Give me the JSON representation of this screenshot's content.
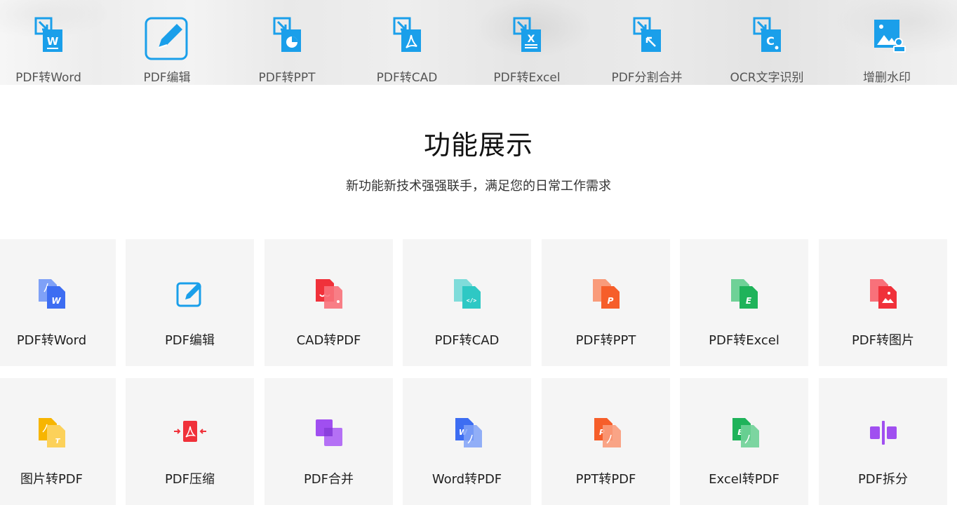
{
  "topbar": {
    "items": [
      {
        "label": "PDF转Word"
      },
      {
        "label": "PDF编辑"
      },
      {
        "label": "PDF转PPT"
      },
      {
        "label": "PDF转CAD"
      },
      {
        "label": "PDF转Excel"
      },
      {
        "label": "PDF分割合并"
      },
      {
        "label": "OCR文字识别"
      },
      {
        "label": "增删水印"
      }
    ]
  },
  "section": {
    "title": "功能展示",
    "subtitle": "新功能新技术强强联手，满足您的日常工作需求"
  },
  "features": {
    "row1": [
      {
        "label": "PDF转Word"
      },
      {
        "label": "PDF编辑"
      },
      {
        "label": "CAD转PDF"
      },
      {
        "label": "PDF转CAD"
      },
      {
        "label": "PDF转PPT"
      },
      {
        "label": "PDF转Excel"
      },
      {
        "label": "PDF转图片"
      }
    ],
    "row2": [
      {
        "label": "图片转PDF"
      },
      {
        "label": "PDF压缩"
      },
      {
        "label": "PDF合并"
      },
      {
        "label": "Word转PDF"
      },
      {
        "label": "PPT转PDF"
      },
      {
        "label": "Excel转PDF"
      },
      {
        "label": "PDF拆分"
      }
    ]
  },
  "colors": {
    "accent_blue": "#1a9fea",
    "word_blue": "#3d6df2",
    "pdf_red": "#f0313a",
    "cad_teal": "#2ec8c4",
    "ppt_orange": "#f65e2a",
    "excel_green": "#1fb35a",
    "image_yellow": "#f7b500",
    "merge_purple": "#a04ff0",
    "card_bg": "#f5f5f5"
  }
}
